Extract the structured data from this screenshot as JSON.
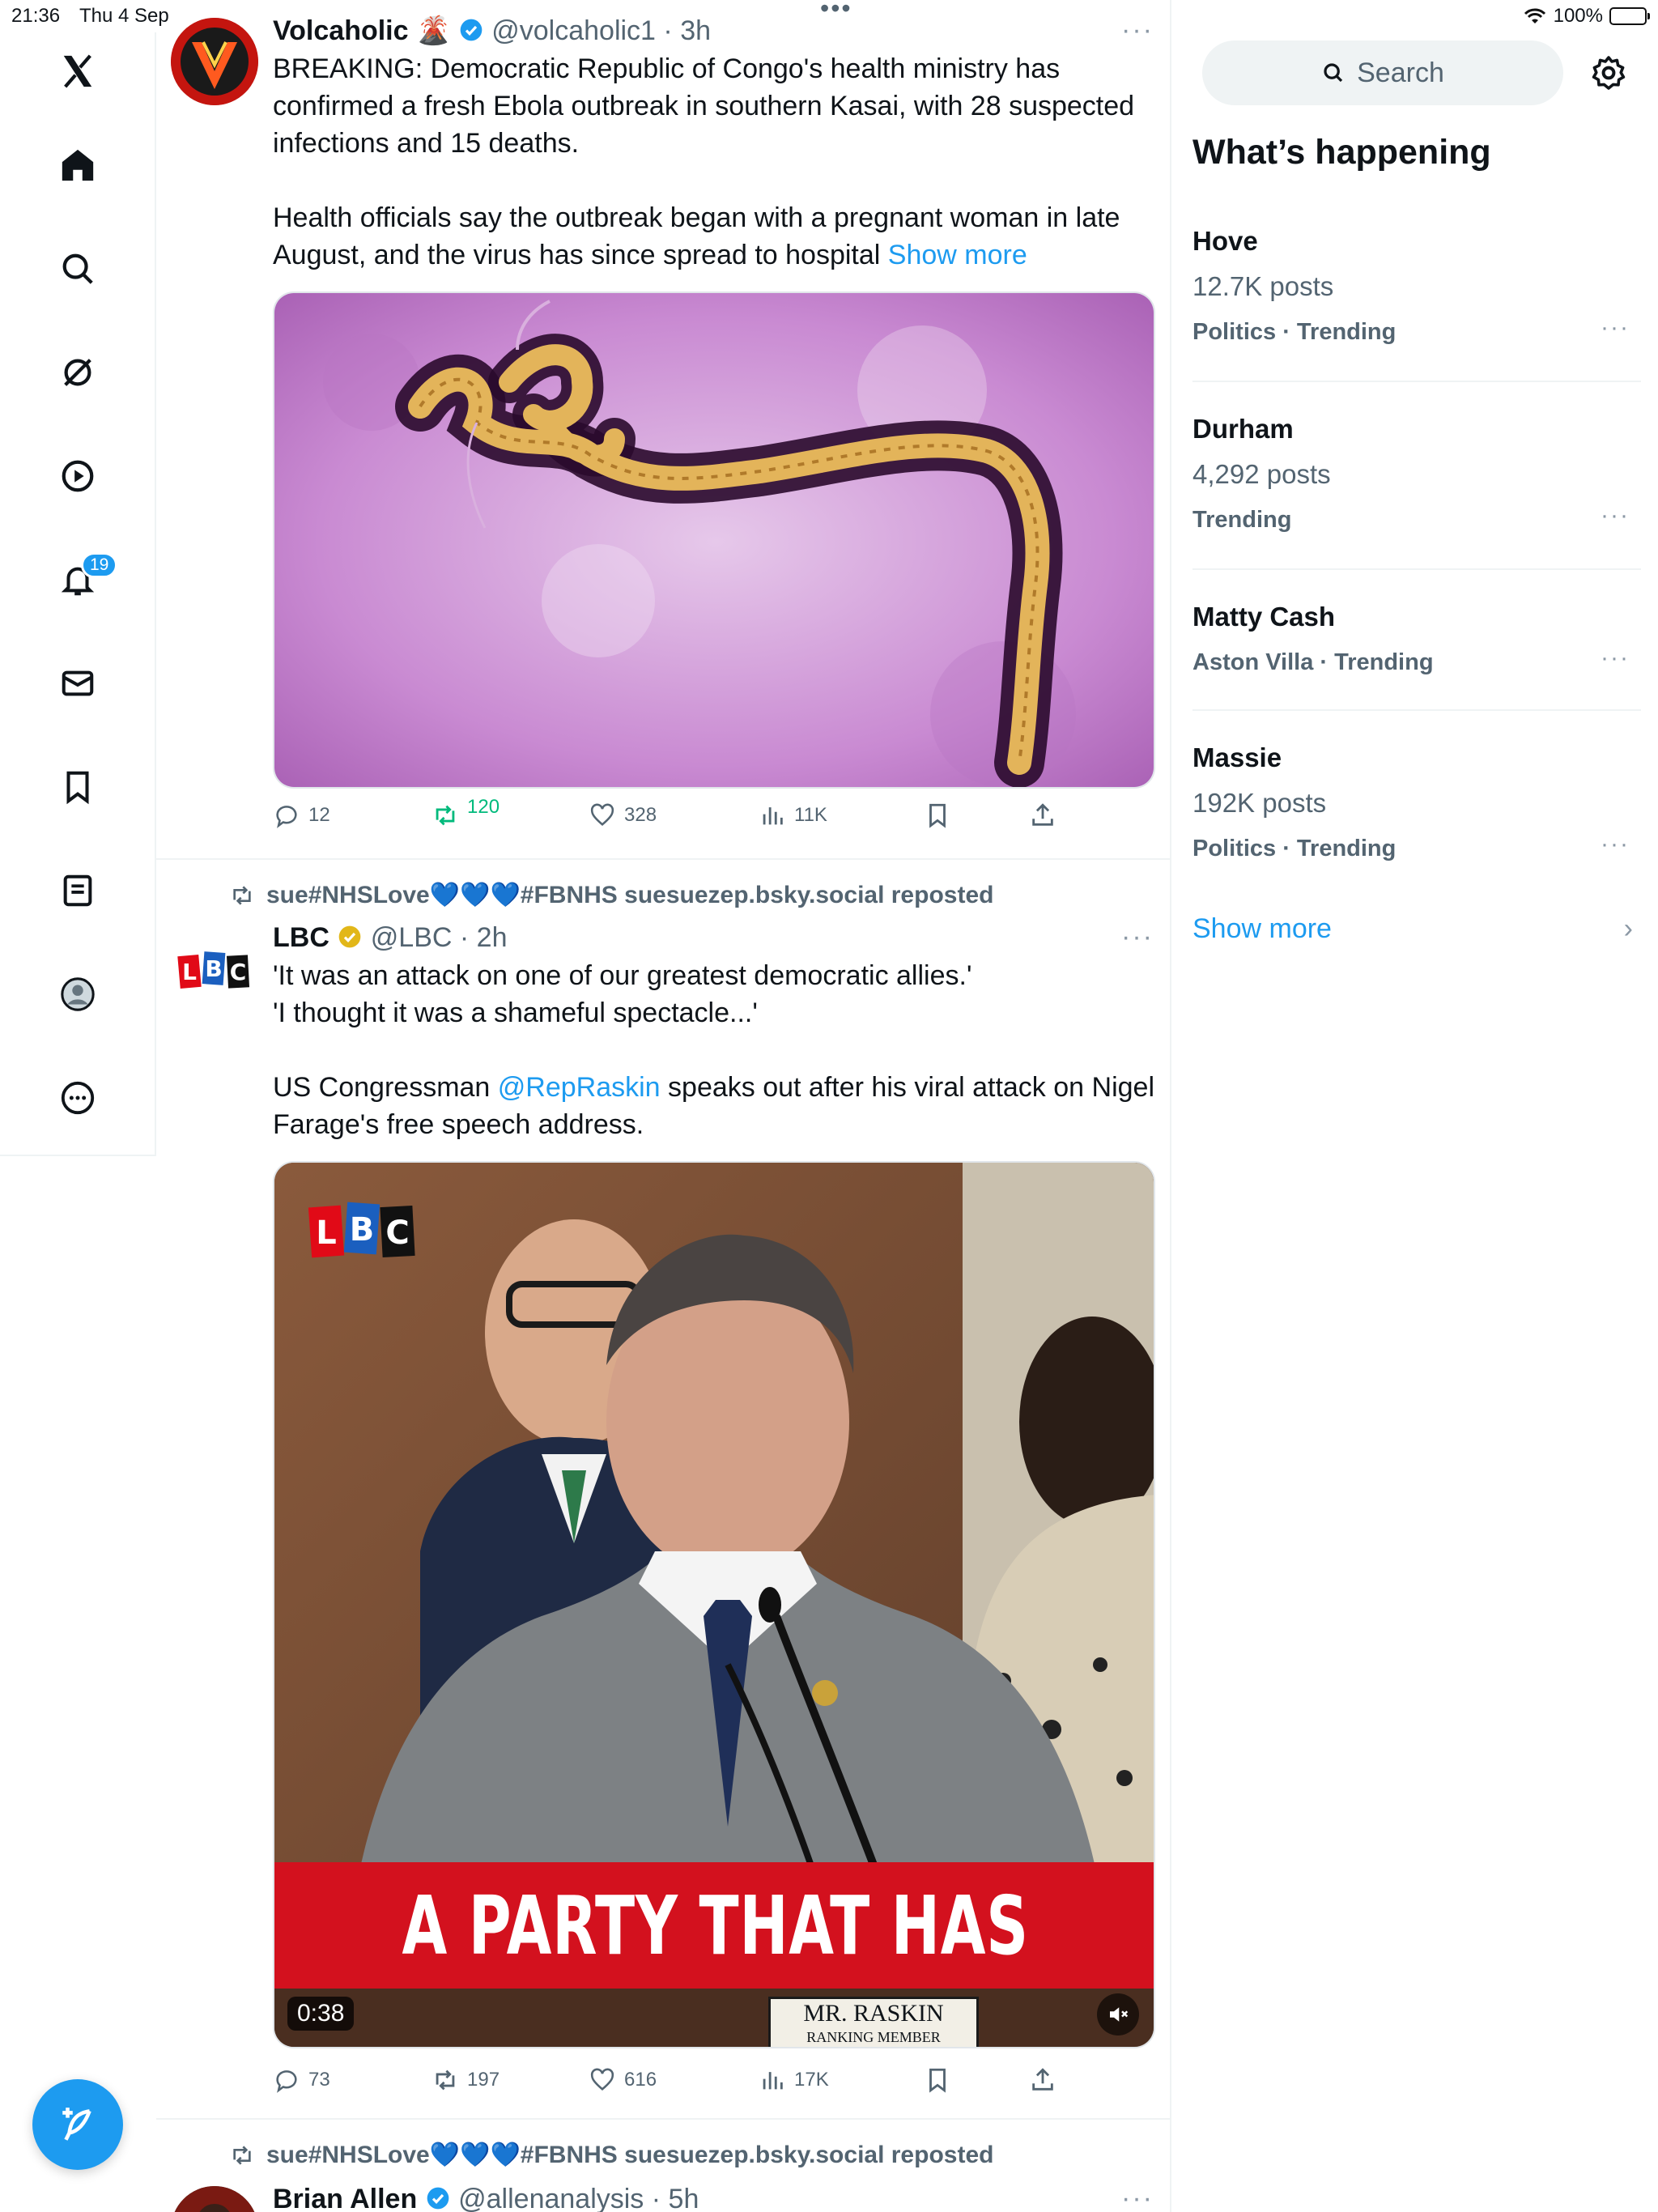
{
  "status_bar": {
    "time": "21:36",
    "date": "Thu 4 Sep",
    "battery": "100%"
  },
  "nav": {
    "notifications_badge": "19"
  },
  "feed": {
    "top_partial": {
      "more": "•••"
    },
    "tweet1": {
      "name": "Volcaholic",
      "emoji": "🌋",
      "handle": "@volcaholic1",
      "time": "3h",
      "text_p1": "BREAKING:  Democratic Republic of Congo's health ministry has confirmed a fresh Ebola outbreak in southern Kasai, with 28 suspected infections and 15 deaths.",
      "text_p2": "Health officials say the outbreak began with a pregnant woman in late August, and the virus has since spread to hospital",
      "show_more": "Show more",
      "replies": "12",
      "reposts": "120",
      "likes": "328",
      "views": "11K"
    },
    "tweet2": {
      "repost_label": "sue#NHSLove💙💙💙#FBNHS suesuezep.bsky.social reposted",
      "name": "LBC",
      "handle": "@LBC",
      "time": "2h",
      "text_p1": "'It was an attack on one of our greatest democratic allies.'",
      "text_p2": "'I thought it was a shameful spectacle...'",
      "text_p3_before": "US Congressman ",
      "text_p3_mention": "@RepRaskin",
      "text_p3_after": " speaks out after his viral attack on Nigel Farage's free speech address.",
      "video_logo": "LBC",
      "video_caption": "A PARTY THAT HAS",
      "video_nameplate": "MR. RASKIN",
      "video_nameplate_sub": "RANKING MEMBER",
      "video_duration": "0:38",
      "replies": "73",
      "reposts": "197",
      "likes": "616",
      "views": "17K"
    },
    "tweet3": {
      "repost_label": "sue#NHSLove💙💙💙#FBNHS suesuezep.bsky.social reposted",
      "name": "Brian Allen",
      "handle": "@allenanalysis",
      "time": "5h"
    }
  },
  "sidebar": {
    "search_placeholder": "Search",
    "title": "What’s happening",
    "trends": [
      {
        "name": "Hove",
        "posts": "12.7K posts",
        "category": "Politics · Trending"
      },
      {
        "name": "Durham",
        "posts": "4,292 posts",
        "category": "Trending"
      },
      {
        "name": "Matty Cash",
        "posts": "",
        "category": "Aston Villa · Trending"
      },
      {
        "name": "Massie",
        "posts": "192K posts",
        "category": "Politics · Trending"
      }
    ],
    "show_more": "Show more"
  },
  "colors": {
    "accent": "#1d9bf0",
    "repost_green": "#00ba7c",
    "lbc_red": "#e10a17"
  }
}
